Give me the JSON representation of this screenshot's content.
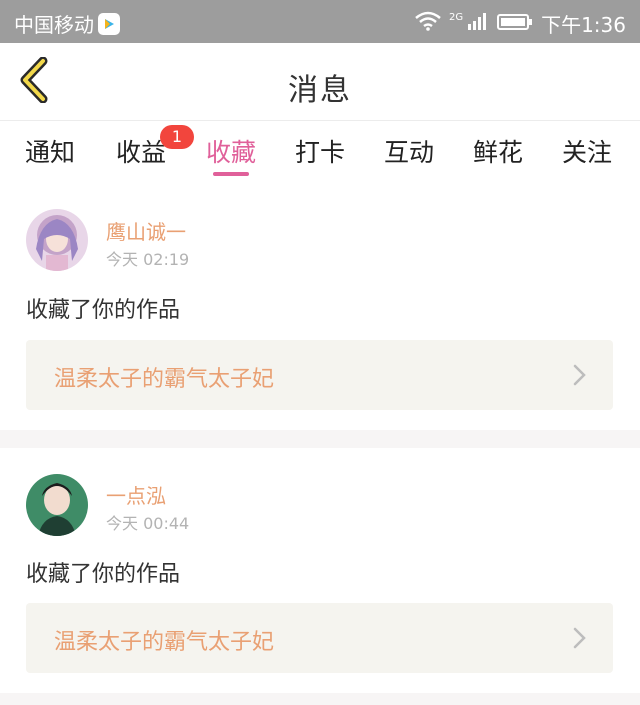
{
  "status_bar": {
    "carrier": "中国移动",
    "network": "2G",
    "time": "下午1:36"
  },
  "header": {
    "title": "消息",
    "back_icon": "chevron-left-icon"
  },
  "tabs": [
    {
      "label": "通知",
      "active": false
    },
    {
      "label": "收益",
      "active": false,
      "badge": "1"
    },
    {
      "label": "收藏",
      "active": true
    },
    {
      "label": "打卡",
      "active": false
    },
    {
      "label": "互动",
      "active": false
    },
    {
      "label": "鲜花",
      "active": false
    },
    {
      "label": "关注",
      "active": false
    }
  ],
  "messages": [
    {
      "username": "鹰山诚一",
      "time": "今天 02:19",
      "action": "收藏了你的作品",
      "work_title": "温柔太子的霸气太子妃"
    },
    {
      "username": "一点泓",
      "time": "今天 00:44",
      "action": "收藏了你的作品",
      "work_title": "温柔太子的霸气太子妃"
    }
  ],
  "colors": {
    "accent_pink": "#e0609a",
    "name_orange": "#e9a073",
    "badge_red": "#f2453d",
    "status_bar": "#9d9d9d"
  }
}
